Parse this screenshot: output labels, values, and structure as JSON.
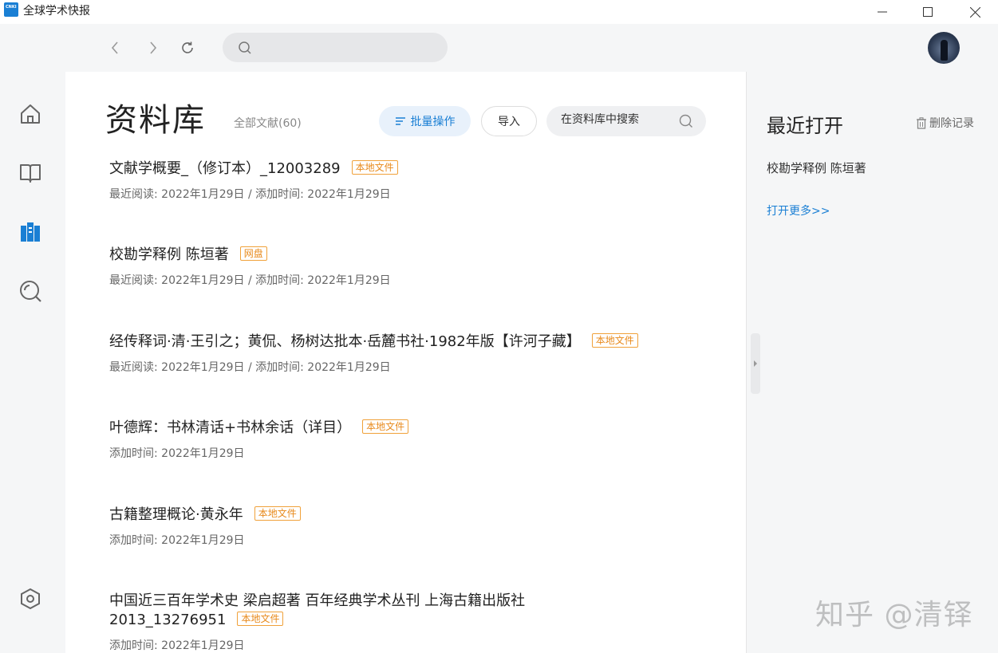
{
  "app": {
    "title": "全球学术快报",
    "logo_text": "CNKI"
  },
  "colors": {
    "accent": "#1a7fd4",
    "tag": "#e8891a"
  },
  "navbar": {
    "search_placeholder": ""
  },
  "sidebar": {
    "items": [
      "home-icon",
      "book-icon",
      "library-icon",
      "discover-icon",
      "settings-icon"
    ],
    "active": "library-icon"
  },
  "main": {
    "title": "资料库",
    "count": "全部文献(60)",
    "batch_label": "批量操作",
    "import_label": "导入",
    "search_placeholder": "在资料库中搜索",
    "items": [
      {
        "title": "文献学概要_（修订本）_12003289",
        "tag": "本地文件",
        "meta": "最近阅读: 2022年1月29日 / 添加时间: 2022年1月29日"
      },
      {
        "title": "校勘学释例 陈垣著",
        "tag": "网盘",
        "meta": "最近阅读: 2022年1月29日 / 添加时间: 2022年1月29日"
      },
      {
        "title": "经传释词·清·王引之；黄侃、杨树达批本·岳麓书社·1982年版【许河子藏】",
        "tag": "本地文件",
        "meta": "最近阅读: 2022年1月29日 / 添加时间: 2022年1月29日"
      },
      {
        "title": "叶德辉：书林清话+书林余话（详目）",
        "tag": "本地文件",
        "meta": "添加时间: 2022年1月29日"
      },
      {
        "title": "古籍整理概论·黄永年",
        "tag": "本地文件",
        "meta": "添加时间: 2022年1月29日"
      },
      {
        "title_line1": "中国近三百年学术史 梁启超著 百年经典学术丛刊 上海古籍出版社",
        "title_line2": "2013_13276951",
        "tag": "本地文件",
        "meta": "添加时间: 2022年1月29日"
      }
    ]
  },
  "right": {
    "title": "最近打开",
    "delete_label": "删除记录",
    "recent": [
      "校勘学释例 陈垣著"
    ],
    "more_label": "打开更多>>"
  },
  "watermark": "知乎 @清铎"
}
